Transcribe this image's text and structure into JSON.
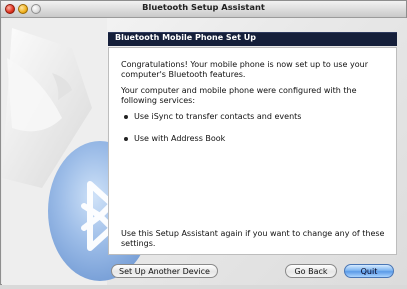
{
  "window": {
    "title": "Bluetooth Setup Assistant"
  },
  "header": {
    "title": "Bluetooth Mobile Phone Set Up"
  },
  "content": {
    "para1": "Congratulations! Your mobile phone is now set up to use your computer's Bluetooth features.",
    "para2": "Your computer and mobile phone were configured with the following services:",
    "bullets": [
      "Use iSync to transfer contacts and events",
      "Use with Address Book"
    ],
    "footer_note": "Use this Setup Assistant again if you want to change any of these settings."
  },
  "buttons": {
    "setup_another": "Set Up Another Device",
    "go_back": "Go Back",
    "quit": "Quit"
  },
  "icons": {
    "background_art": "tuxedo-bluetooth-icon"
  },
  "colors": {
    "header_bg": "#151f3a",
    "primary_button": "#5b9ae7"
  }
}
